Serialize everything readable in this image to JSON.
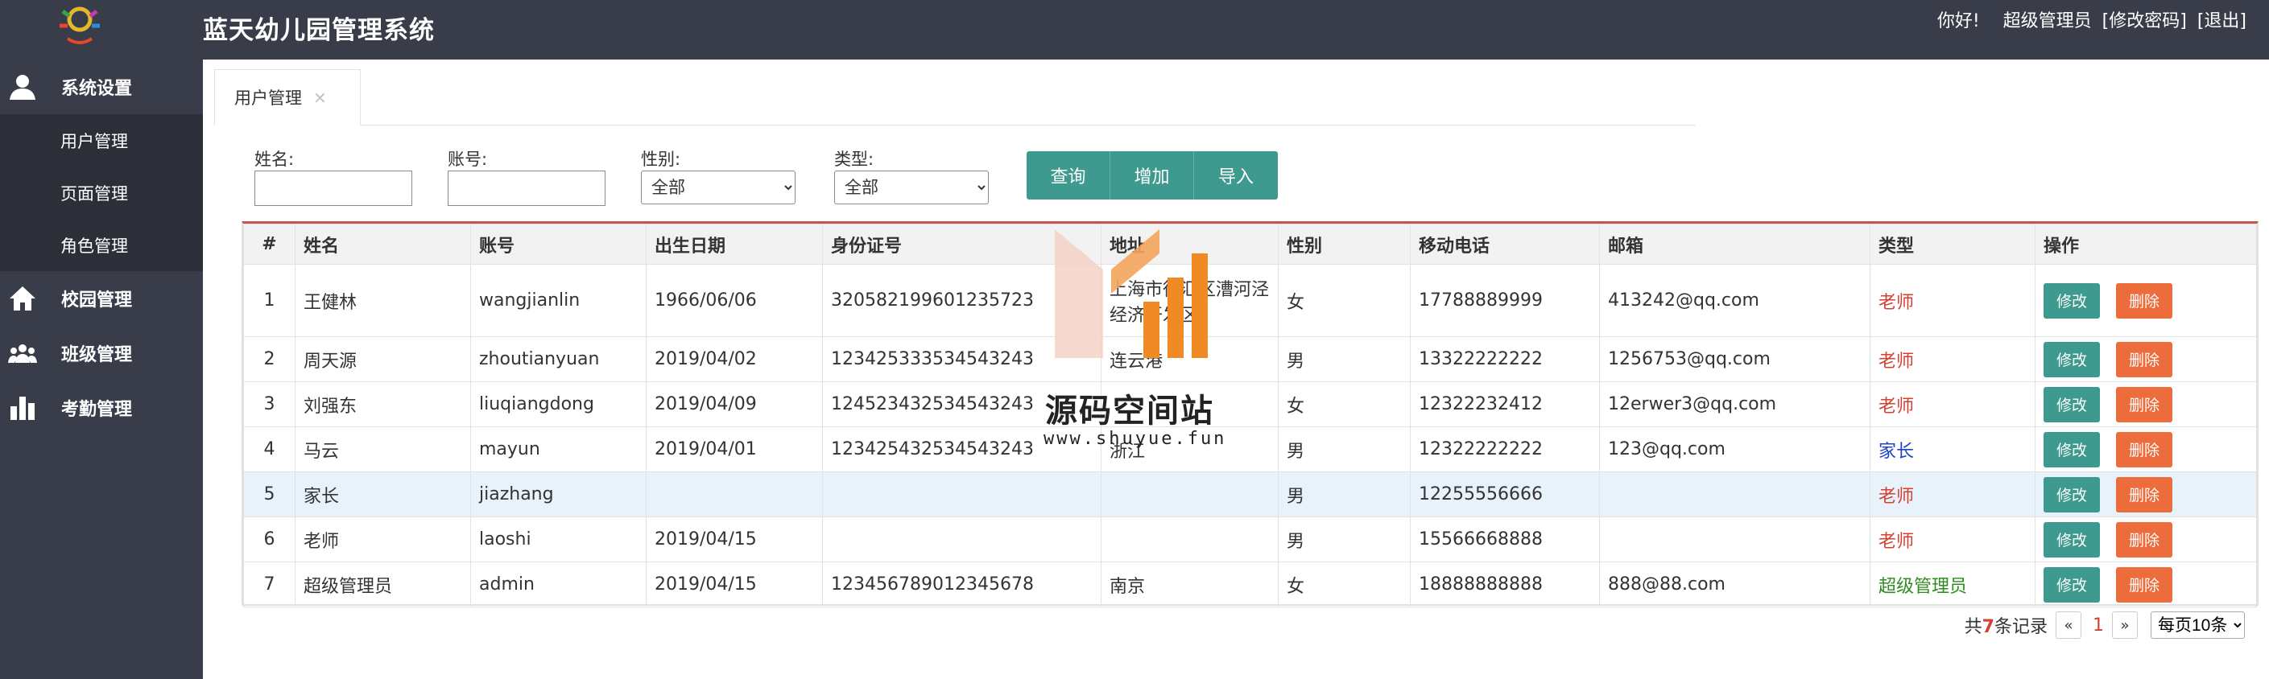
{
  "app": {
    "title": "蓝天幼儿园管理系统"
  },
  "user_bar": {
    "greeting": "你好!",
    "role": "超级管理员",
    "change_password": "[修改密码]",
    "logout": "[退出]"
  },
  "sidebar": {
    "groups": [
      {
        "label": "系统设置",
        "icon": "user-icon"
      },
      {
        "label": "校园管理",
        "icon": "home-icon"
      },
      {
        "label": "班级管理",
        "icon": "users-icon"
      },
      {
        "label": "考勤管理",
        "icon": "bar-chart-icon"
      }
    ],
    "sub_items": [
      "用户管理",
      "页面管理",
      "角色管理"
    ]
  },
  "tab": {
    "label": "用户管理",
    "close": "×"
  },
  "search": {
    "name_label": "姓名:",
    "name_value": "",
    "account_label": "账号:",
    "account_value": "",
    "gender_label": "性别:",
    "gender_value": "全部",
    "type_label": "类型:",
    "type_value": "全部"
  },
  "buttons": {
    "query": "查询",
    "add": "增加",
    "import": "导入"
  },
  "table": {
    "headers": [
      "#",
      "姓名",
      "账号",
      "出生日期",
      "身份证号",
      "地址",
      "性别",
      "移动电话",
      "邮箱",
      "类型",
      "操作"
    ],
    "edit_label": "修改",
    "delete_label": "删除",
    "rows": [
      {
        "no": "1",
        "name": "王健林",
        "account": "wangjianlin",
        "birth": "1966/06/06",
        "id": "320582199601235723",
        "addr": "上海市徐汇区漕河泾经济开发区",
        "gender": "女",
        "phone": "17788889999",
        "email": "413242@qq.com",
        "type": "老师",
        "type_color": "#d43f2f"
      },
      {
        "no": "2",
        "name": "周天源",
        "account": "zhoutianyuan",
        "birth": "2019/04/02",
        "id": "123425333534543243",
        "addr": "连云港",
        "gender": "男",
        "phone": "13322222222",
        "email": "1256753@qq.com",
        "type": "老师",
        "type_color": "#d43f2f"
      },
      {
        "no": "3",
        "name": "刘强东",
        "account": "liuqiangdong",
        "birth": "2019/04/09",
        "id": "124523432534543243",
        "addr": "",
        "gender": "女",
        "phone": "12322232412",
        "email": "12erwer3@qq.com",
        "type": "老师",
        "type_color": "#d43f2f"
      },
      {
        "no": "4",
        "name": "马云",
        "account": "mayun",
        "birth": "2019/04/01",
        "id": "123425432534543243",
        "addr": "浙江",
        "gender": "男",
        "phone": "12322222222",
        "email": "123@qq.com",
        "type": "家长",
        "type_color": "#1d44c8"
      },
      {
        "no": "5",
        "name": "家长",
        "account": "jiazhang",
        "birth": "",
        "id": "",
        "addr": "",
        "gender": "男",
        "phone": "12255556666",
        "email": "",
        "type": "老师",
        "type_color": "#d43f2f"
      },
      {
        "no": "6",
        "name": "老师",
        "account": "laoshi",
        "birth": "2019/04/15",
        "id": "",
        "addr": "",
        "gender": "男",
        "phone": "15566668888",
        "email": "",
        "type": "老师",
        "type_color": "#d43f2f"
      },
      {
        "no": "7",
        "name": "超级管理员",
        "account": "admin",
        "birth": "2019/04/15",
        "id": "123456789012345678",
        "addr": "南京",
        "gender": "女",
        "phone": "18888888888",
        "email": "888@88.com",
        "type": "超级管理员",
        "type_color": "#2f8c1f"
      }
    ]
  },
  "pager": {
    "total_prefix": "共",
    "total_count": "7",
    "total_suffix": "条记录",
    "prev": "«",
    "current": "1",
    "next": "»",
    "page_size": "每页10条"
  },
  "watermark": {
    "text": "源码空间站",
    "url": "www.shuyue.fun"
  }
}
